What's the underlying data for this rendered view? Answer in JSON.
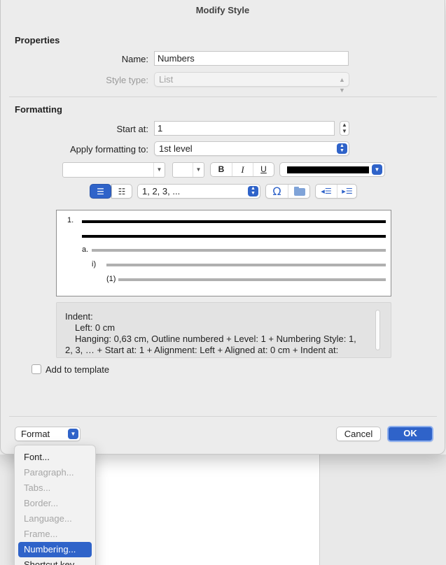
{
  "window": {
    "title": "Modify Style"
  },
  "properties": {
    "heading": "Properties",
    "name_label": "Name:",
    "name_value": "Numbers",
    "style_type_label": "Style type:",
    "style_type_value": "List"
  },
  "formatting": {
    "heading": "Formatting",
    "start_at_label": "Start at:",
    "start_at_value": "1",
    "apply_label": "Apply formatting to:",
    "apply_value": "1st level",
    "font_name": "",
    "font_size": "",
    "bold": "B",
    "italic": "I",
    "underline": "U",
    "font_color": "#000000",
    "number_style": "1, 2, 3, ..."
  },
  "preview": {
    "level1": "1.",
    "level2": "a.",
    "level3": "i)",
    "level4": "(1)"
  },
  "description": {
    "line1": "Indent:",
    "line2": "Left:  0 cm",
    "line3": "Hanging:  0,63 cm, Outline numbered + Level: 1 + Numbering Style: 1,",
    "line4": "2, 3, … + Start at: 1 + Alignment: Left + Aligned at:  0 cm + Indent at:"
  },
  "add_to_template_label": "Add to template",
  "footer": {
    "format_label": "Format",
    "cancel_label": "Cancel",
    "ok_label": "OK"
  },
  "format_menu": {
    "items": [
      {
        "label": "Font...",
        "enabled": true
      },
      {
        "label": "Paragraph...",
        "enabled": false
      },
      {
        "label": "Tabs...",
        "enabled": false
      },
      {
        "label": "Border...",
        "enabled": false
      },
      {
        "label": "Language...",
        "enabled": false
      },
      {
        "label": "Frame...",
        "enabled": false
      },
      {
        "label": "Numbering...",
        "enabled": true,
        "highlighted": true
      },
      {
        "label": "Shortcut key...",
        "enabled": true
      }
    ]
  },
  "colors": {
    "accent": "#2f63c9"
  }
}
